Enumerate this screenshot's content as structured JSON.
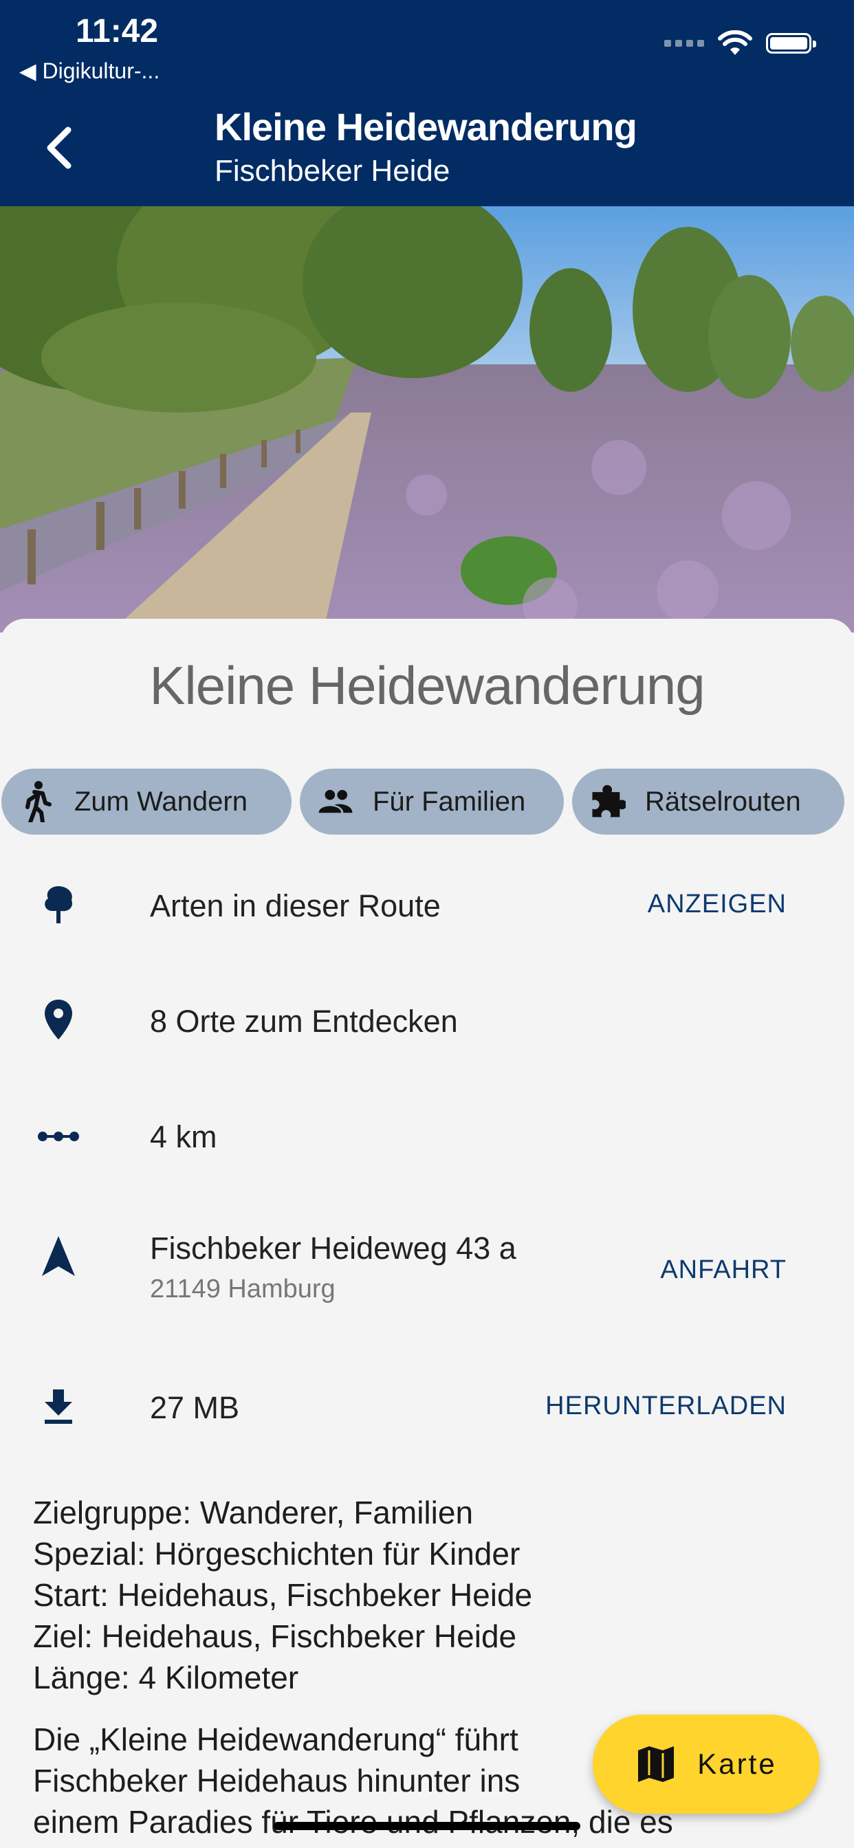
{
  "status_bar": {
    "time": "11:42",
    "back_app": "◀ Digikultur-..."
  },
  "header": {
    "title": "Kleine Heidewanderung",
    "subtitle": "Fischbeker Heide"
  },
  "hero": {
    "alt": ""
  },
  "sheet": {
    "title": "Kleine Heidewanderung",
    "chips": [
      {
        "label": "Zum Wandern",
        "icon": "walk-icon"
      },
      {
        "label": "Für Familien",
        "icon": "people-icon"
      },
      {
        "label": "Rätselrouten",
        "icon": "puzzle-icon"
      }
    ],
    "rows": {
      "species": {
        "label": "Arten in dieser Route",
        "action": "ANZEIGEN"
      },
      "places": {
        "label": "8 Orte zum Entdecken"
      },
      "distance": {
        "label": "4 km"
      },
      "address": {
        "label": "Fischbeker Heideweg 43 a",
        "sublabel": "21149 Hamburg",
        "action": "ANFAHRT"
      },
      "download": {
        "label": "27 MB",
        "action": "HERUNTERLADEN"
      }
    },
    "info_lines": [
      "Zielgruppe: Wanderer, Familien",
      "Spezial: Hörgeschichten für Kinder",
      "Start: Heidehaus, Fischbeker Heide",
      "Ziel: Heidehaus, Fischbeker Heide",
      "Länge: 4 Kilometer"
    ],
    "description_lines": [
      "Die „Kleine Heidewanderung“ führt",
      "Fischbeker Heidehaus hinunter ins",
      "einem Paradies für Tiere und Pflanzen, die es"
    ]
  },
  "fab": {
    "label": "Karte"
  },
  "colors": {
    "header": "#022c63",
    "chip": "#a2b3c8",
    "accent_text": "#0d3a6e",
    "fab": "#ffd42c"
  }
}
